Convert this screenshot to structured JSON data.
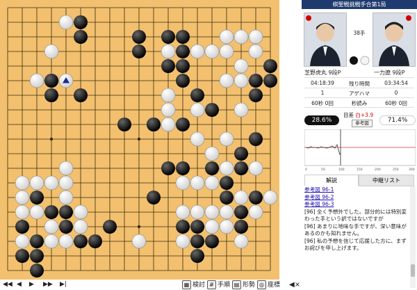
{
  "title": "棋聖戦挑戦手合第1局",
  "move_label": "38手",
  "left_player": {
    "name": "芝野虎丸 9段P",
    "flag": "red-circle-flag-icon",
    "stone": "black"
  },
  "right_player": {
    "name": "一力遼 9段P",
    "flag": "red-circle-flag-icon",
    "stone": "white"
  },
  "time": {
    "left": "04:18:39",
    "label": "残り時間",
    "right": "03:34:54"
  },
  "agehama": {
    "left": "1",
    "label": "アゲハマ",
    "right": "0"
  },
  "byoyomi": {
    "left": "60秒 0回",
    "label": "秒読み",
    "right": "60秒 0回"
  },
  "diff": {
    "label": "目差",
    "value": "白+3.9"
  },
  "reference_button": "参考図",
  "winrate": {
    "black": "28.6%",
    "white": "71.4%"
  },
  "graph_axis": [
    "0",
    "50",
    "100",
    "150",
    "200",
    "250",
    "300"
  ],
  "tabs": [
    "解説",
    "中継リスト"
  ],
  "comment_links": [
    "参考図 96-1",
    "参考図 96-2",
    "参考図 96-3"
  ],
  "comments": [
    "[96] 全く予想外でした。部分的には特別変わった手という訳ではないですが",
    "[96] あまりに地味な手ですが、深い意味があるのかも知れません。",
    "[96] 私の予想を信じて応援した方に、まずお詫びを申し上げます。"
  ],
  "toolbar": {
    "first": "◀◀",
    "prev": "◀",
    "next": "▶",
    "fast": "▶▶",
    "last": "▶|",
    "moves_label": "検討",
    "order_label": "手順",
    "shape_label": "形勢",
    "coords_label": "座標",
    "sound_icon": "speaker-icon"
  },
  "board": {
    "size": 19,
    "black": [
      [
        5,
        1
      ],
      [
        5,
        2
      ],
      [
        9,
        2
      ],
      [
        11,
        2
      ],
      [
        12,
        2
      ],
      [
        9,
        3
      ],
      [
        12,
        3
      ],
      [
        3,
        5
      ],
      [
        11,
        4
      ],
      [
        12,
        4
      ],
      [
        17,
        5
      ],
      [
        18,
        5
      ],
      [
        18,
        4
      ],
      [
        12,
        5
      ],
      [
        13,
        6
      ],
      [
        3,
        6
      ],
      [
        5,
        6
      ],
      [
        17,
        6
      ],
      [
        14,
        7
      ],
      [
        8,
        8
      ],
      [
        12,
        8
      ],
      [
        10,
        8
      ],
      [
        10,
        13
      ],
      [
        11,
        11
      ],
      [
        12,
        11
      ],
      [
        14,
        11
      ],
      [
        16,
        11
      ],
      [
        16,
        10
      ],
      [
        17,
        9
      ],
      [
        15,
        12
      ],
      [
        17,
        13
      ],
      [
        16,
        14
      ],
      [
        15,
        13
      ],
      [
        16,
        15
      ],
      [
        12,
        15
      ],
      [
        13,
        15
      ],
      [
        13,
        16
      ],
      [
        14,
        16
      ],
      [
        13,
        17
      ],
      [
        7,
        15
      ],
      [
        6,
        16
      ],
      [
        5,
        16
      ],
      [
        4,
        15
      ],
      [
        2,
        13
      ],
      [
        3,
        14
      ],
      [
        4,
        14
      ],
      [
        1,
        15
      ],
      [
        1,
        17
      ],
      [
        2,
        18
      ],
      [
        2,
        16
      ],
      [
        2,
        17
      ]
    ],
    "white": [
      [
        4,
        1
      ],
      [
        3,
        3
      ],
      [
        2,
        5
      ],
      [
        3,
        5
      ],
      [
        11,
        3
      ],
      [
        13,
        3
      ],
      [
        14,
        3
      ],
      [
        15,
        3
      ],
      [
        15,
        2
      ],
      [
        16,
        2
      ],
      [
        17,
        2
      ],
      [
        17,
        3
      ],
      [
        16,
        4
      ],
      [
        16,
        5
      ],
      [
        15,
        5
      ],
      [
        11,
        6
      ],
      [
        13,
        7
      ],
      [
        11,
        7
      ],
      [
        10,
        8
      ],
      [
        11,
        8
      ],
      [
        16,
        7
      ],
      [
        13,
        9
      ],
      [
        15,
        9
      ],
      [
        14,
        10
      ],
      [
        14,
        12
      ],
      [
        12,
        12
      ],
      [
        13,
        12
      ],
      [
        15,
        11
      ],
      [
        17,
        11
      ],
      [
        18,
        13
      ],
      [
        17,
        14
      ],
      [
        16,
        13
      ],
      [
        14,
        14
      ],
      [
        14,
        15
      ],
      [
        15,
        14
      ],
      [
        12,
        14
      ],
      [
        13,
        14
      ],
      [
        15,
        15
      ],
      [
        16,
        16
      ],
      [
        12,
        16
      ],
      [
        9,
        16
      ],
      [
        5,
        15
      ],
      [
        5,
        14
      ],
      [
        4,
        12
      ],
      [
        4,
        13
      ],
      [
        3,
        12
      ],
      [
        2,
        12
      ],
      [
        1,
        12
      ],
      [
        1,
        13
      ],
      [
        2,
        14
      ],
      [
        1,
        14
      ],
      [
        3,
        15
      ],
      [
        3,
        16
      ],
      [
        4,
        16
      ],
      [
        1,
        16
      ],
      [
        4,
        11
      ]
    ],
    "last_move": [
      4,
      5
    ],
    "hoshi": [
      [
        3,
        3
      ],
      [
        9,
        3
      ],
      [
        15,
        3
      ],
      [
        3,
        9
      ],
      [
        9,
        9
      ],
      [
        15,
        9
      ],
      [
        3,
        15
      ],
      [
        9,
        15
      ],
      [
        15,
        15
      ]
    ]
  }
}
